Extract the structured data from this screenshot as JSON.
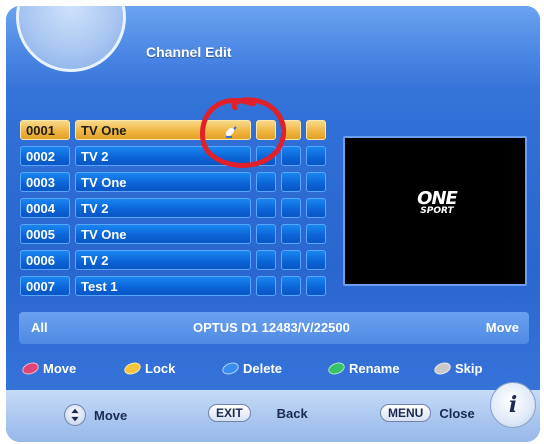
{
  "header": {
    "title": "Channel Edit"
  },
  "channels": [
    {
      "number": "0001",
      "name": "TV One",
      "selected": true
    },
    {
      "number": "0002",
      "name": "TV 2",
      "selected": false
    },
    {
      "number": "0003",
      "name": "TV One",
      "selected": false
    },
    {
      "number": "0004",
      "name": "TV 2",
      "selected": false
    },
    {
      "number": "0005",
      "name": "TV One",
      "selected": false
    },
    {
      "number": "0006",
      "name": "TV 2",
      "selected": false
    },
    {
      "number": "0007",
      "name": "Test 1",
      "selected": false
    }
  ],
  "preview": {
    "logo_main": "ONE",
    "logo_sub": "SPORT"
  },
  "info_bar": {
    "left": "All",
    "center": "OPTUS D1 12483/V/22500",
    "right": "Move"
  },
  "legend": [
    {
      "label": "Move",
      "color": "#e0457a",
      "icon": "red-dot-icon"
    },
    {
      "label": "Lock",
      "color": "#f2c53a",
      "icon": "yellow-dot-icon"
    },
    {
      "label": "Delete",
      "color": "#3b8cf0",
      "icon": "blue-dot-icon"
    },
    {
      "label": "Rename",
      "color": "#37c26a",
      "icon": "green-dot-icon"
    },
    {
      "label": "Skip",
      "color": "#c9c9c9",
      "icon": "white-dot-icon"
    }
  ],
  "bottom": {
    "move_label": "Move",
    "exit_key": "EXIT",
    "back_label": "Back",
    "menu_key": "MENU",
    "close_label": "Close",
    "info_glyph": "i"
  },
  "colors": {
    "annotation_circle": "#e0202a",
    "selected_row": "#efb43c",
    "row_blue": "#0b63d6"
  }
}
